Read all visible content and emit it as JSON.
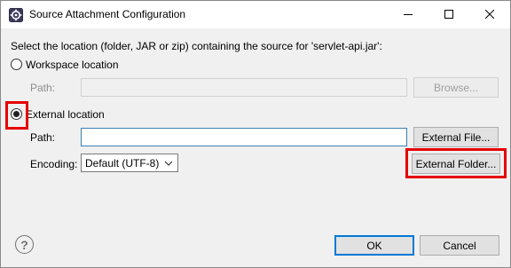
{
  "window": {
    "title": "Source Attachment Configuration",
    "icon": "eclipse-gear-icon"
  },
  "dialog": {
    "description": "Select the location (folder, JAR or zip) containing the source for 'servlet-api.jar':",
    "workspace": {
      "radio_label": "Workspace location",
      "selected": false,
      "path_label": "Path:",
      "path_value": "",
      "browse_label": "Browse..."
    },
    "external": {
      "radio_label": "External location",
      "selected": true,
      "path_label": "Path:",
      "path_value": "",
      "external_file_label": "External File...",
      "encoding_label": "Encoding:",
      "encoding_value": "Default (UTF-8)",
      "external_folder_label": "External Folder..."
    }
  },
  "footer": {
    "help_glyph": "?",
    "ok_label": "OK",
    "cancel_label": "Cancel"
  },
  "colors": {
    "highlight": "#e60000",
    "default_button_border": "#0078d7"
  }
}
